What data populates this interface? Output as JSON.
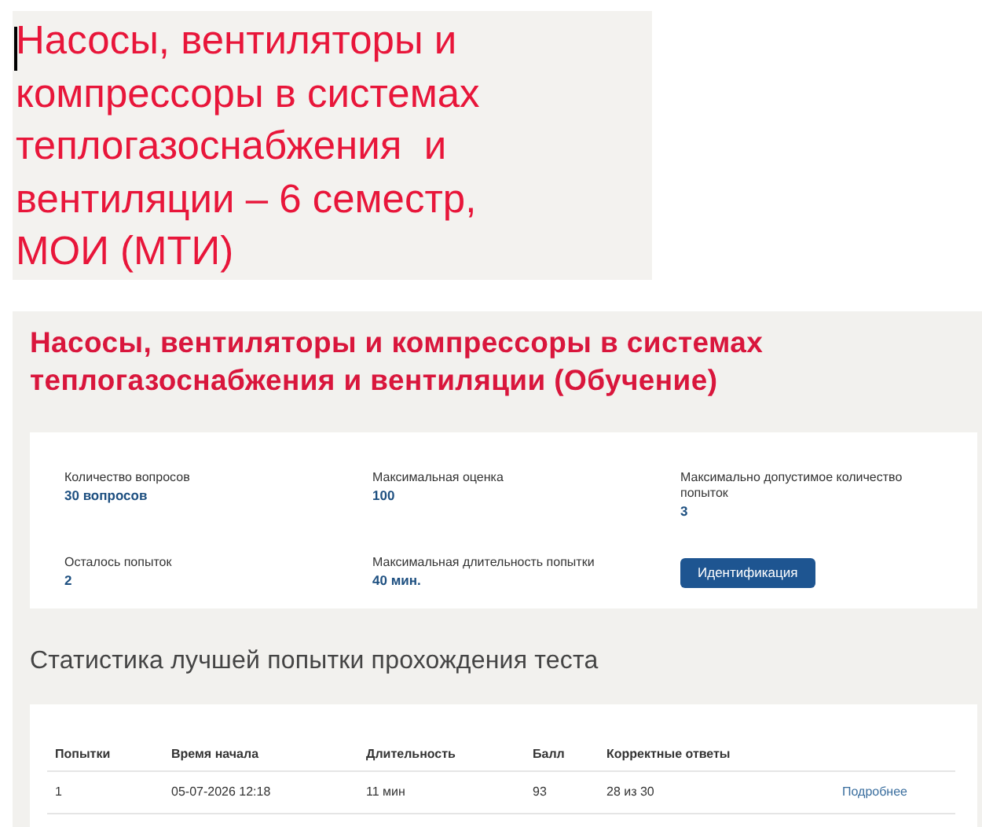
{
  "heading_block": {
    "lines": [
      "Насосы, вентиляторы и",
      "компрессоры в системах",
      "теплогазоснабжения  и",
      "вентиляции – 6 семестр,",
      "МОИ (МТИ)"
    ]
  },
  "course": {
    "title": "Насосы, вентиляторы и компрессоры в системах теплогазоснабжения и вентиляции (Обучение)",
    "info": [
      {
        "label": "Количество вопросов",
        "value": "30 вопросов"
      },
      {
        "label": "Максимальная оценка",
        "value": "100"
      },
      {
        "label": "Максимально допустимое количество попыток",
        "value": "3"
      },
      {
        "label": "Осталось попыток",
        "value": "2"
      },
      {
        "label": "Максимальная длительность попытки",
        "value": "40 мин."
      }
    ],
    "button": "Идентификация"
  },
  "stats": {
    "title": "Статистика лучшей попытки прохождения теста",
    "table": {
      "columns": [
        "Попытки",
        "Время начала",
        "Длительность",
        "Балл",
        "Корректные ответы"
      ],
      "rows": [
        {
          "cells": [
            "1",
            "05-07-2026 12:18",
            "11 мин",
            "93",
            "28 из 30"
          ],
          "link": "Подробнее"
        }
      ]
    }
  }
}
